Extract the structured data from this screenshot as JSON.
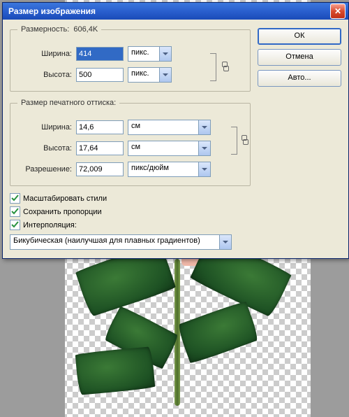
{
  "dialog": {
    "title": "Размер изображения",
    "close_label": "✕",
    "buttons": {
      "ok": "ОК",
      "cancel": "Отмена",
      "auto": "Авто..."
    },
    "dimension": {
      "label": "Размерность:",
      "value": "606,4K",
      "width_label": "Ширина:",
      "width_value": "414",
      "width_unit": "пикс.",
      "height_label": "Высота:",
      "height_value": "500",
      "height_unit": "пикс."
    },
    "print": {
      "legend": "Размер печатного оттиска:",
      "width_label": "Ширина:",
      "width_value": "14,6",
      "width_unit": "см",
      "height_label": "Высота:",
      "height_value": "17,64",
      "height_unit": "см",
      "res_label": "Разрешение:",
      "res_value": "72,009",
      "res_unit": "пикс/дюйм"
    },
    "checks": {
      "scale_styles": "Масштабировать стили",
      "constrain": "Сохранить пропорции",
      "resample": "Интерполяция:"
    },
    "interp": "Бикубическая (наилучшая для плавных градиентов)"
  }
}
